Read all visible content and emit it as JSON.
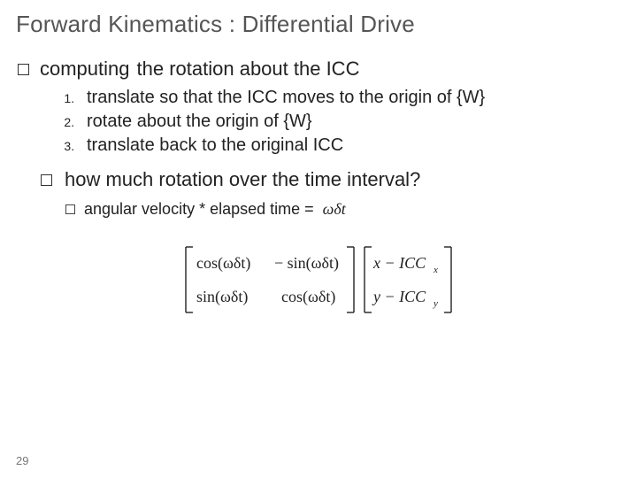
{
  "title": "Forward Kinematics : Differential Drive",
  "bullet1_lead": "computing",
  "bullet1_rest": "the rotation about the ICC",
  "steps": [
    "translate so that the ICC moves to the origin of {W}",
    "rotate about the origin of {W}",
    "translate back to the original ICC"
  ],
  "bullet2": "how much rotation over the time interval?",
  "subbullet": "angular velocity * elapsed time =",
  "omega_dt": "ωδt",
  "matrix": {
    "a11": "cos(ωδt)",
    "a12": "− sin(ωδt)",
    "a21": "sin(ωδt)",
    "a22": "cos(ωδt)",
    "v1a": "x − ICC",
    "v1sub": "x",
    "v2a": "y − ICC",
    "v2sub": "y"
  },
  "page": "29"
}
